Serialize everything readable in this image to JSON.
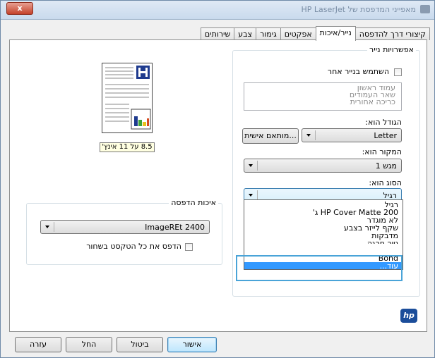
{
  "window": {
    "title": "מאפייני המדפסת של HP LaserJet",
    "close_label": "x"
  },
  "tabs": [
    {
      "label": "קיצורי דרך להדפסה"
    },
    {
      "label": "נייר/איכות"
    },
    {
      "label": "אפקטים"
    },
    {
      "label": "גימור"
    },
    {
      "label": "צבע"
    },
    {
      "label": "שירותים"
    }
  ],
  "paper_options": {
    "legend": "אפשרויות נייר",
    "use_different_paper_label": "השתמש בנייר אחר",
    "list_items": [
      "עמוד ראשון",
      "שאר העמודים",
      "כריכה אחורית"
    ],
    "size_label": "הגודל הוא:",
    "size_value": "Letter",
    "custom_button": "מותאם אישית...",
    "source_label": "המקור הוא:",
    "source_value": "מגש 1",
    "type_label": "הסוג הוא:",
    "type_value": "רגיל",
    "type_options": [
      "רגיל",
      "HP Cover Matte 200 ג'",
      "לא מוגדר",
      "שקף לייזר בצבע",
      "מדבקות",
      "נייר חרגה",
      "Bond",
      "עוד..."
    ]
  },
  "preview": {
    "size_label": "8.5 על 11 אינץ'"
  },
  "print_quality": {
    "legend": "איכות הדפסה",
    "quality_value": "ImageREt 2400",
    "print_text_black_label": "הדפס את כל הטקסט בשחור"
  },
  "footer": {
    "ok": "אישור",
    "cancel": "ביטול",
    "apply": "החל",
    "help": "עזרה"
  },
  "brand": {
    "logo_text": "hp"
  },
  "colors": {
    "accent": "#3399ff",
    "highlight_border": "#4aa4d8"
  }
}
